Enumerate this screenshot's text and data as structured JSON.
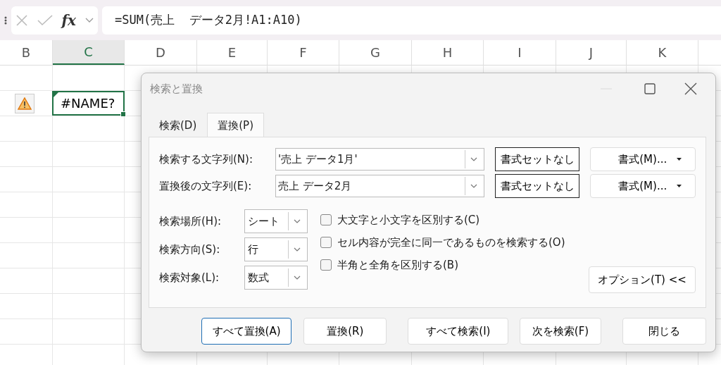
{
  "formula_bar": {
    "function_label": "fx",
    "formula": "=SUM(売上  データ2月!A1:A10)"
  },
  "sheet": {
    "columns": [
      {
        "label": "B",
        "selected": false
      },
      {
        "label": "C",
        "selected": true
      },
      {
        "label": "D",
        "selected": false
      },
      {
        "label": "E",
        "selected": false
      },
      {
        "label": "F",
        "selected": false
      },
      {
        "label": "G",
        "selected": false
      },
      {
        "label": "H",
        "selected": false
      },
      {
        "label": "I",
        "selected": false
      },
      {
        "label": "J",
        "selected": false
      },
      {
        "label": "K",
        "selected": false
      }
    ],
    "active_cell": {
      "value": "#NAME?"
    }
  },
  "dialog": {
    "title": "検索と置換",
    "tabs": [
      {
        "label": "検索(D)",
        "selected": false
      },
      {
        "label": "置換(P)",
        "selected": true
      }
    ],
    "text_fields": [
      {
        "label": "検索する文字列(N):",
        "value": "'売上 データ1月'",
        "format_status": "書式セットなし",
        "format_button": "書式(M)..."
      },
      {
        "label": "置換後の文字列(E):",
        "value": "売上 データ2月",
        "format_status": "書式セットなし",
        "format_button": "書式(M)..."
      }
    ],
    "selects": [
      {
        "label": "検索場所(H):",
        "value": "シート"
      },
      {
        "label": "検索方向(S):",
        "value": "行"
      },
      {
        "label": "検索対象(L):",
        "value": "数式"
      }
    ],
    "checkboxes": [
      {
        "label": "大文字と小文字を区別する(C)",
        "checked": false
      },
      {
        "label": "セル内容が完全に同一であるものを検索する(O)",
        "checked": false
      },
      {
        "label": "半角と全角を区別する(B)",
        "checked": false
      }
    ],
    "options_button": "オプション(T) <<",
    "buttons": [
      {
        "label": "すべて置換(A)",
        "selected": true
      },
      {
        "label": "置換(R)",
        "selected": false
      },
      {
        "label": "すべて検索(I)",
        "selected": false
      },
      {
        "label": "次を検索(F)",
        "selected": false
      },
      {
        "label": "閉じる",
        "selected": false
      }
    ]
  }
}
